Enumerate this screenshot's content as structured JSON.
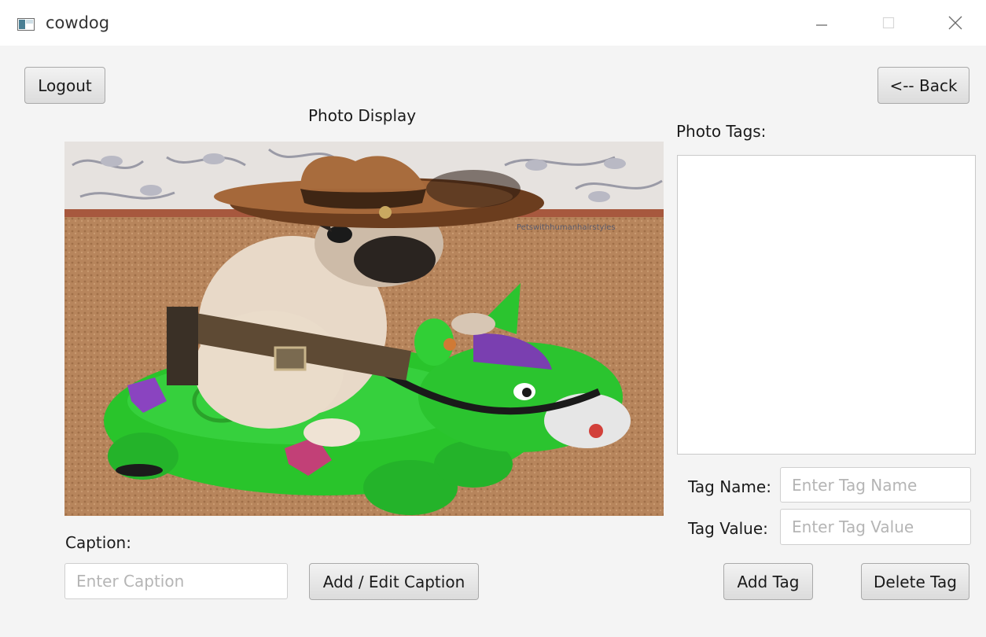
{
  "window": {
    "title": "cowdog",
    "icon": "app-window-icon",
    "controls": [
      "minimize-icon",
      "maximize-icon",
      "close-icon"
    ]
  },
  "toolbar": {
    "logout_label": "Logout",
    "back_label": "<-- Back"
  },
  "photo": {
    "heading": "Photo Display",
    "overlay_text": "Petswithhumanhairstyles"
  },
  "caption": {
    "label": "Caption:",
    "placeholder": "Enter Caption",
    "button_label": "Add / Edit Caption"
  },
  "tags": {
    "heading": "Photo Tags:",
    "items": [],
    "name_label": "Tag Name:",
    "name_placeholder": "Enter Tag Name",
    "value_label": "Tag Value:",
    "value_placeholder": "Enter Tag Value",
    "add_label": "Add Tag",
    "delete_label": "Delete Tag"
  }
}
